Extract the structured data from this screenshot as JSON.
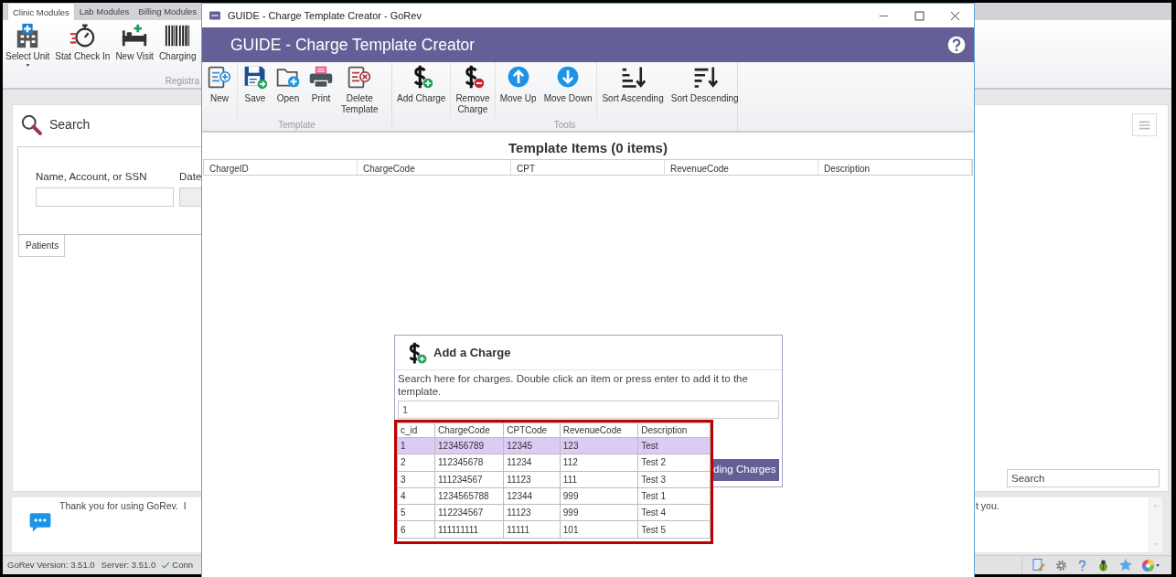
{
  "background_app": {
    "module_tabs": [
      {
        "label": "Clinic Modules",
        "selected": true
      },
      {
        "label": "Lab Modules",
        "selected": false
      },
      {
        "label": "Billing Modules",
        "selected": false
      }
    ],
    "ribbon_buttons": [
      {
        "label": "Select Unit",
        "dropdown": true
      },
      {
        "label": "Stat Check In",
        "dropdown": false
      },
      {
        "label": "New Visit",
        "dropdown": false
      },
      {
        "label": "Charging",
        "dropdown": false
      }
    ],
    "ribbon_group_label": "Registra",
    "search_panel": {
      "title": "Search",
      "field_label": "Name, Account, or SSN",
      "date_label": "Date",
      "tabs": [
        {
          "label": "Patients",
          "selected": true
        }
      ],
      "search_box": {
        "value": "Search"
      }
    },
    "message_parts": [
      "Thank you for using GoRev.  I",
      "t you."
    ],
    "status_bar": {
      "version": "GoRev Version: 3.51.0",
      "server": "Server: 3.51.0",
      "connection": "Conn"
    }
  },
  "dialog": {
    "title": "GUIDE - Charge Template Creator - GoRev",
    "header": "GUIDE - Charge Template Creator",
    "ribbon_groups": [
      {
        "label": "Template",
        "clusters": [
          [
            {
              "label": "New"
            }
          ],
          [
            {
              "label": "Save"
            },
            {
              "label": "Open"
            },
            {
              "label": "Print"
            },
            {
              "label": "Delete\nTemplate"
            }
          ]
        ]
      },
      {
        "label": "Tools",
        "clusters": [
          [
            {
              "label": "Add Charge"
            }
          ],
          [
            {
              "label": "Remove\nCharge"
            }
          ],
          [
            {
              "label": "Move Up"
            },
            {
              "label": "Move Down"
            }
          ],
          [
            {
              "label": "Sort Ascending"
            },
            {
              "label": "Sort Descending"
            }
          ]
        ]
      }
    ],
    "template_items_title": "Template Items (0 items)",
    "columns": [
      "ChargeID",
      "ChargeCode",
      "CPT",
      "RevenueCode",
      "Description"
    ],
    "add_charge": {
      "title": "Add a Charge",
      "instructions": "Search here for charges. Double click an item or press enter to add it to the template.",
      "search_value": "1",
      "button_label": "ding Charges",
      "results": {
        "columns": [
          "c_id",
          "ChargeCode",
          "CPTCode",
          "RevenueCode",
          "Description"
        ],
        "rows": [
          {
            "cells": [
              "1",
              "123456789",
              "12345",
              "123",
              "Test"
            ],
            "selected": true
          },
          {
            "cells": [
              "2",
              "112345678",
              "11234",
              "112",
              "Test 2"
            ],
            "selected": false
          },
          {
            "cells": [
              "3",
              "111234567",
              "11123",
              "111",
              "Test 3"
            ],
            "selected": false
          },
          {
            "cells": [
              "4",
              "1234565788",
              "12344",
              "999",
              "Test 1"
            ],
            "selected": false
          },
          {
            "cells": [
              "5",
              "112234567",
              "11123",
              "999",
              "Test 4"
            ],
            "selected": false
          },
          {
            "cells": [
              "6",
              "111111111",
              "11111",
              "101",
              "Test 5"
            ],
            "selected": false
          }
        ]
      }
    }
  }
}
